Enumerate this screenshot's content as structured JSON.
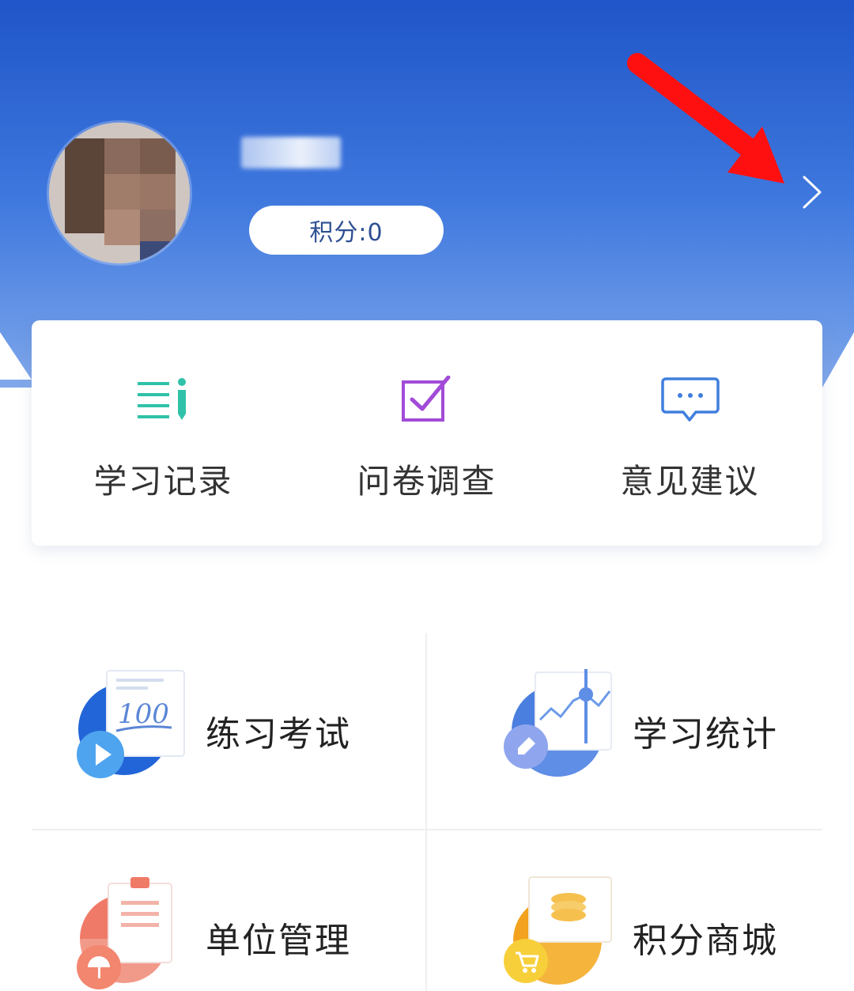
{
  "profile": {
    "points_label": "积分:0"
  },
  "quick_actions": [
    {
      "label": "学习记录",
      "icon": "study-record-icon"
    },
    {
      "label": "问卷调查",
      "icon": "survey-checkbox-icon"
    },
    {
      "label": "意见建议",
      "icon": "feedback-chat-icon"
    }
  ],
  "grid": [
    {
      "label": "练习考试",
      "icon": "practice-exam-icon"
    },
    {
      "label": "学习统计",
      "icon": "study-statistics-icon"
    },
    {
      "label": "单位管理",
      "icon": "unit-management-icon"
    },
    {
      "label": "积分商城",
      "icon": "points-mall-icon"
    }
  ],
  "colors": {
    "header_top": "#1f55c8",
    "header_bottom": "#9db9ef",
    "points_text": "#2d4f92",
    "teal_icon": "#2fc2a8",
    "purple_icon": "#a24bd8",
    "blue_icon": "#3f7fde",
    "annotation_red": "#ff1010"
  }
}
